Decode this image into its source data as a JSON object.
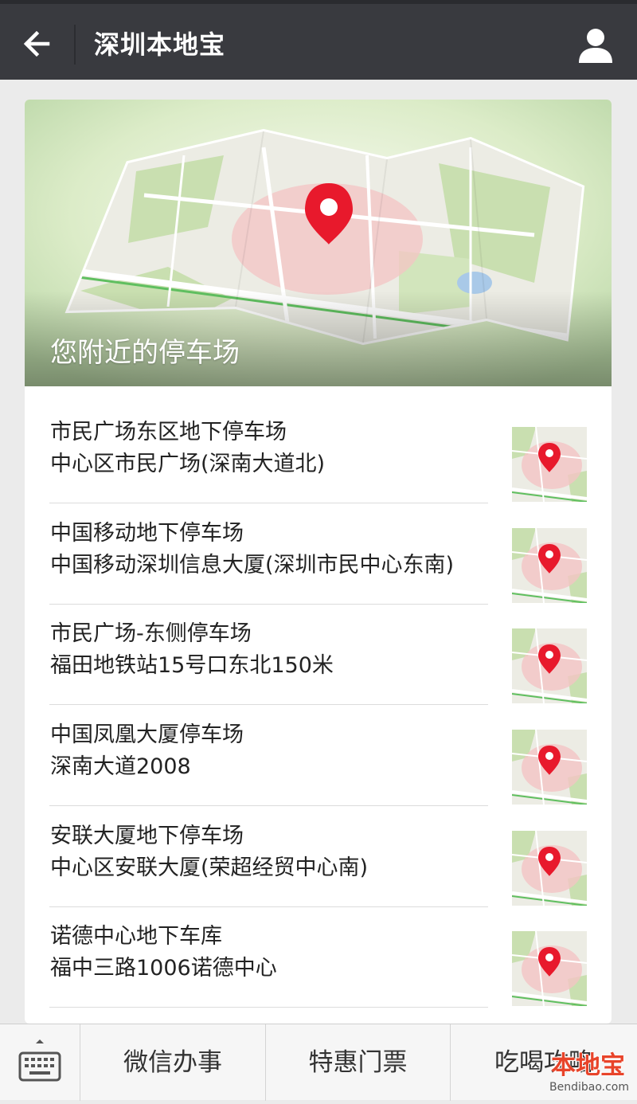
{
  "header": {
    "title": "深圳本地宝"
  },
  "banner": {
    "title": "您附近的停车场"
  },
  "parking_list": [
    {
      "name": "市民广场东区地下停车场",
      "address": "中心区市民广场(深南大道北)"
    },
    {
      "name": "中国移动地下停车场",
      "address": "中国移动深圳信息大厦(深圳市民中心东南)"
    },
    {
      "name": "市民广场-东侧停车场",
      "address": "福田地铁站15号口东北150米"
    },
    {
      "name": "中国凤凰大厦停车场",
      "address": "深南大道2008"
    },
    {
      "name": "安联大厦地下停车场",
      "address": "中心区安联大厦(荣超经贸中心南)"
    },
    {
      "name": "诺德中心地下车库",
      "address": "福中三路1006诺德中心"
    }
  ],
  "bottom_menu": [
    {
      "label": "微信办事"
    },
    {
      "label": "特惠门票"
    },
    {
      "label": "吃喝攻略"
    }
  ],
  "watermark": {
    "logo": "本地宝",
    "url": "Bendibao.com"
  },
  "icons": {
    "back": "arrow-left-icon",
    "user": "user-icon",
    "keyboard": "keyboard-icon",
    "pin": "map-pin-icon"
  },
  "colors": {
    "topbar": "#393a3f",
    "pin": "#e8192c",
    "background": "#ebebeb"
  }
}
